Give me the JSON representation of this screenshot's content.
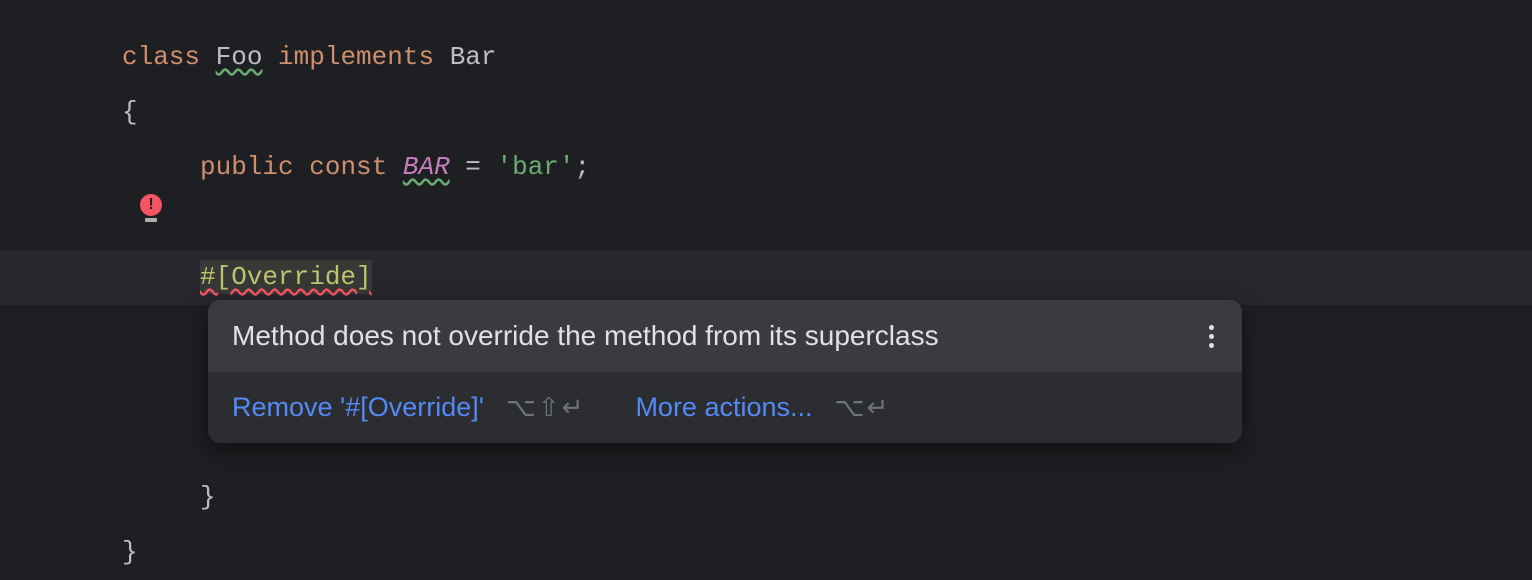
{
  "code": {
    "line1": {
      "kw_class": "class",
      "name": "Foo",
      "kw_impl": "implements",
      "iface": "Bar"
    },
    "line2": {
      "brace": "{"
    },
    "line3": {
      "kw_public": "public",
      "kw_const": "const",
      "name": "BAR",
      "eq": " = ",
      "val": "'bar'",
      "semi": ";"
    },
    "line4": {
      "attr": "#[Override]"
    },
    "line5": {
      "brace": "}"
    },
    "line6": {
      "brace": "}"
    }
  },
  "popup": {
    "message": "Method does not override the method from its superclass",
    "action1": "Remove '#[Override]'",
    "shortcut1": "⌥⇧↵",
    "action2": "More actions...",
    "shortcut2": "⌥↵"
  }
}
